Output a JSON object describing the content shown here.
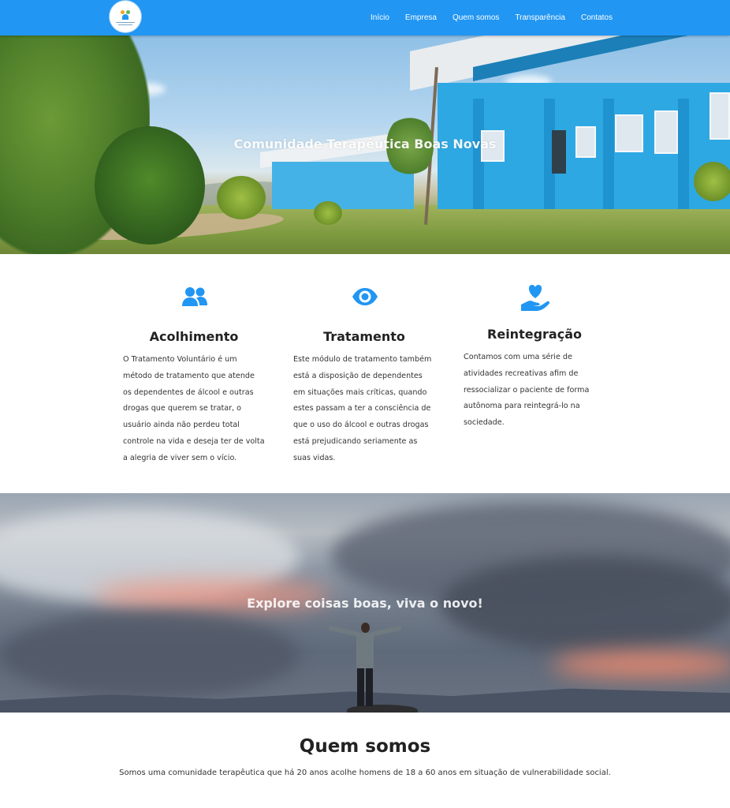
{
  "nav": {
    "items": [
      {
        "label": "Início"
      },
      {
        "label": "Empresa"
      },
      {
        "label": "Quem somos"
      },
      {
        "label": "Transparência"
      },
      {
        "label": "Contatos"
      }
    ]
  },
  "hero1": {
    "title": "Comunidade Terapêutica Boas Novas"
  },
  "features": [
    {
      "icon": "people-icon",
      "title": "Acolhimento",
      "text": "O Tratamento Voluntário é um método de tratamento que atende os dependentes de álcool e outras drogas que querem se tratar, o usuário ainda não perdeu total controle na vida e deseja ter de volta a alegria de viver sem o vício."
    },
    {
      "icon": "eye-icon",
      "title": "Tratamento",
      "text": "Este módulo de tratamento também está a disposição de dependentes em situações mais críticas, quando estes passam a ter a consciência de que o uso do álcool e outras drogas está prejudicando seriamente as suas vidas."
    },
    {
      "icon": "hand-heart-icon",
      "title": "Reintegração",
      "text": "Contamos com uma série de atividades recreativas afim de ressocializar o paciente de forma autônoma para reintegrá-lo na sociedade."
    }
  ],
  "hero2": {
    "title": "Explore coisas boas, viva o novo!"
  },
  "about": {
    "title": "Quem somos",
    "text": "Somos uma comunidade terapêutica que há 20 anos acolhe homens de 18 a 60 anos em situação de vulnerabilidade social."
  },
  "colors": {
    "accent": "#2196f3",
    "icon": "#2196f3"
  }
}
